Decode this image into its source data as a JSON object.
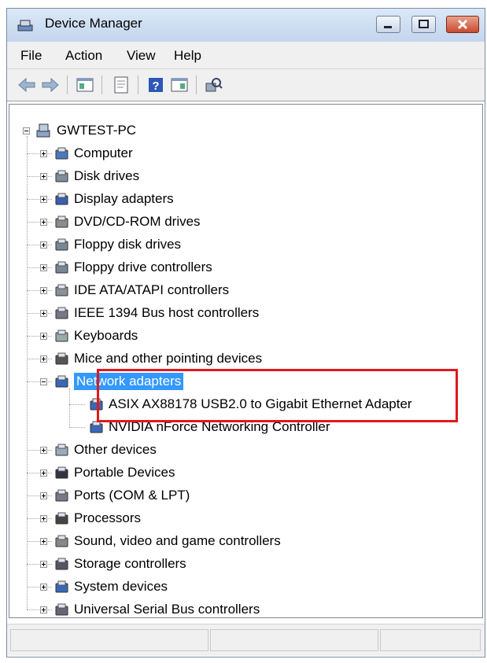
{
  "window": {
    "title": "Device Manager"
  },
  "menu": [
    "File",
    "Action",
    "View",
    "Help"
  ],
  "tree": {
    "root": "GWTEST-PC",
    "categories": [
      {
        "label": "Computer",
        "icon": "computer-icon"
      },
      {
        "label": "Disk drives",
        "icon": "disk-drive-icon"
      },
      {
        "label": "Display adapters",
        "icon": "display-adapter-icon"
      },
      {
        "label": "DVD/CD-ROM drives",
        "icon": "dvd-drive-icon"
      },
      {
        "label": "Floppy disk drives",
        "icon": "floppy-drive-icon"
      },
      {
        "label": "Floppy drive controllers",
        "icon": "floppy-controller-icon"
      },
      {
        "label": "IDE ATA/ATAPI controllers",
        "icon": "ide-controller-icon"
      },
      {
        "label": "IEEE 1394 Bus host controllers",
        "icon": "ieee1394-icon"
      },
      {
        "label": "Keyboards",
        "icon": "keyboard-icon"
      },
      {
        "label": "Mice and other pointing devices",
        "icon": "mouse-icon"
      },
      {
        "label": "Network adapters",
        "icon": "network-adapter-icon",
        "expanded": true,
        "selected": true,
        "children": [
          {
            "label": "ASIX AX88178 USB2.0 to Gigabit Ethernet Adapter",
            "icon": "network-adapter-icon"
          },
          {
            "label": "NVIDIA nForce Networking Controller",
            "icon": "network-adapter-icon"
          }
        ]
      },
      {
        "label": "Other devices",
        "icon": "unknown-device-icon"
      },
      {
        "label": "Portable Devices",
        "icon": "portable-device-icon"
      },
      {
        "label": "Ports (COM & LPT)",
        "icon": "port-icon"
      },
      {
        "label": "Processors",
        "icon": "processor-icon"
      },
      {
        "label": "Sound, video and game controllers",
        "icon": "sound-icon"
      },
      {
        "label": "Storage controllers",
        "icon": "storage-controller-icon"
      },
      {
        "label": "System devices",
        "icon": "system-device-icon"
      },
      {
        "label": "Universal Serial Bus controllers",
        "icon": "usb-icon"
      }
    ]
  },
  "colors": {
    "selection": "#3399ff",
    "highlight_box": "#e0191c"
  }
}
